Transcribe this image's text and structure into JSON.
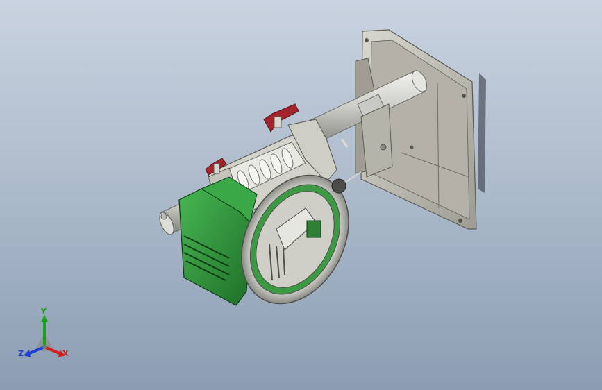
{
  "viewport": {
    "background_top": "#c9d3e0",
    "background_bottom": "#8c9db3"
  },
  "model": {
    "parts": [
      "mounting-plate",
      "main-shaft",
      "worm-screw-housing",
      "clamp-levers",
      "handwheel",
      "motor-housing"
    ],
    "colors": {
      "gray_body": "#c8c7bf",
      "mounting_plate": "#bdbbb1",
      "motor_green": "#2f9a3a",
      "lever_red": "#a3242a",
      "handwheel": "#d6d6d0"
    }
  },
  "triad": {
    "x_label": "X",
    "y_label": "Y",
    "z_label": "Z",
    "x_color": "#d32020",
    "y_color": "#1aa01a",
    "z_color": "#1e3fd0"
  }
}
